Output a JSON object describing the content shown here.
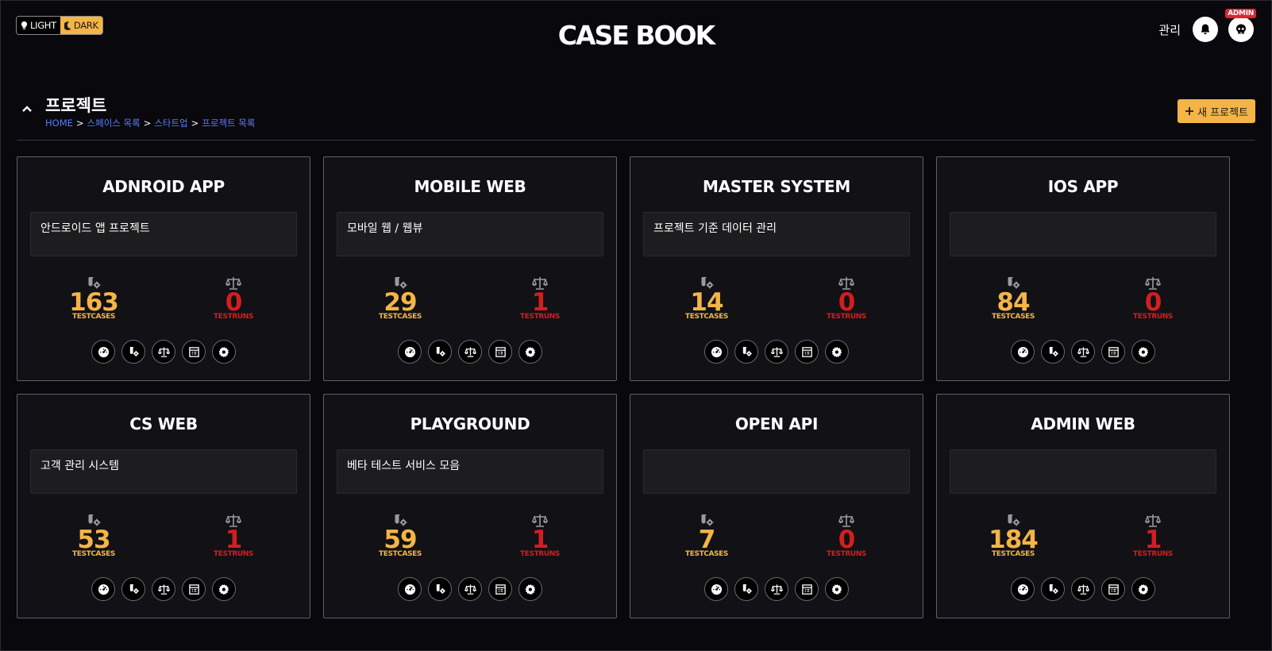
{
  "theme": {
    "light_label": "LIGHT",
    "dark_label": "DARK",
    "active": "dark"
  },
  "app": {
    "logo": "CASE BOOK"
  },
  "topbar": {
    "admin_link": "관리",
    "badge": "ADMIN"
  },
  "header": {
    "title": "프로젝트",
    "breadcrumb": [
      "HOME",
      "스페이스 목록",
      "스타트업",
      "프로젝트 목록"
    ],
    "breadcrumb_sep": ">",
    "new_project_label": "새 프로젝트"
  },
  "colors": {
    "accent": "#f4b446",
    "danger": "#d41e1e",
    "link": "#5b7cff"
  },
  "stat_labels": {
    "testcases": "TESTCASES",
    "testruns": "TESTRUNS"
  },
  "card_actions": [
    "dashboard-icon",
    "testcase-icon",
    "testrun-icon",
    "report-icon",
    "settings-icon"
  ],
  "projects": [
    {
      "name": "ADNROID APP",
      "description": "안드로이드 앱 프로젝트",
      "testcases": "163",
      "testruns": "0"
    },
    {
      "name": "MOBILE WEB",
      "description": "모바일 웹 / 웹뷰",
      "testcases": "29",
      "testruns": "1"
    },
    {
      "name": "MASTER SYSTEM",
      "description": "프로젝트 기준 데이터 관리",
      "testcases": "14",
      "testruns": "0"
    },
    {
      "name": "IOS APP",
      "description": "",
      "testcases": "84",
      "testruns": "0"
    },
    {
      "name": "CS WEB",
      "description": "고객 관리 시스템",
      "testcases": "53",
      "testruns": "1"
    },
    {
      "name": "PLAYGROUND",
      "description": "베타 테스트 서비스 모음",
      "testcases": "59",
      "testruns": "1"
    },
    {
      "name": "OPEN API",
      "description": "",
      "testcases": "7",
      "testruns": "0"
    },
    {
      "name": "ADMIN WEB",
      "description": "",
      "testcases": "184",
      "testruns": "1"
    }
  ]
}
